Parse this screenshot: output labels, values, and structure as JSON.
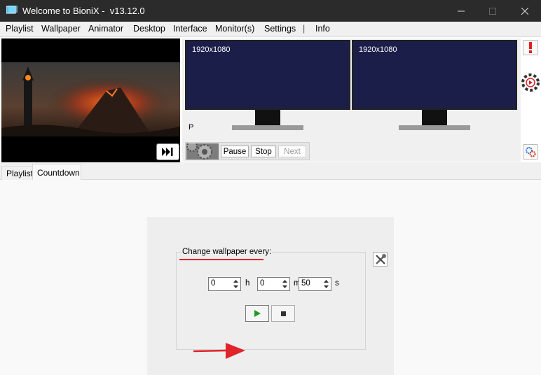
{
  "window": {
    "title": "Welcome to BioniX -  v13.12.0",
    "icons": {
      "app": "bionix-app-icon",
      "minimize": "minimize-icon",
      "maximize": "maximize-icon",
      "close": "close-icon"
    }
  },
  "menu": {
    "items": [
      "Playlist",
      "Wallpaper",
      "Animator",
      "Desktop",
      "Interface",
      "Monitor(s)",
      "Settings",
      "|",
      "Info"
    ]
  },
  "preview": {
    "next_icon": "skip-next-icon"
  },
  "monitors": [
    {
      "resolution": "1920x1080"
    },
    {
      "resolution": "1920x1080"
    }
  ],
  "monitors_panel": {
    "p_label": "P"
  },
  "controls": {
    "pause": "Pause",
    "stop": "Stop",
    "next": "Next",
    "next_enabled": false
  },
  "side_buttons": [
    "alert-icon",
    "record-icon",
    "settings-gears-icon"
  ],
  "tabs": [
    {
      "label": "Playlist",
      "active": false
    },
    {
      "label": "Countdown",
      "active": true
    }
  ],
  "countdown": {
    "group_label": "Change wallpaper every:",
    "hours": "0",
    "hours_unit": "h",
    "minutes": "0",
    "minutes_unit": "m",
    "seconds": "50",
    "seconds_unit": "s",
    "start_icon": "play-icon",
    "stop_icon": "stop-icon",
    "tools_icon": "tools-icon"
  },
  "colors": {
    "titlebar": "#2b2b2b",
    "monitor_screen": "#1c1e4a",
    "annotation_red": "#e0242a",
    "play_green": "#1f9a1f"
  }
}
